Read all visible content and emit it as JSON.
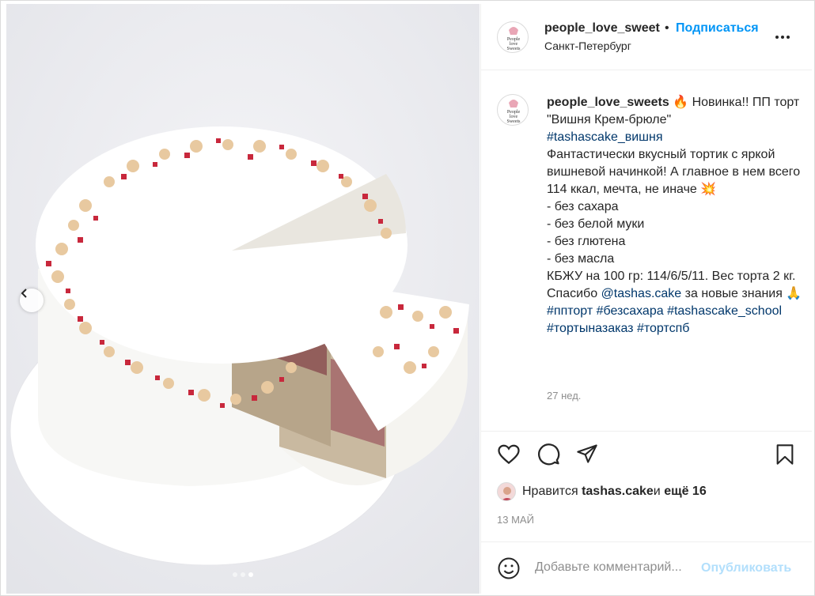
{
  "post": {
    "username": "people_love_sweet",
    "separator": "•",
    "follow_label": "Подписаться",
    "location": "Санкт-Петербург"
  },
  "caption": {
    "username": "people_love_sweets",
    "fire_emoji": "🔥",
    "line1": " Новинка!! ПП торт \"Вишня Крем-брюле\"",
    "tag1": "#tashascake_вишня",
    "text1": "Фантастически вкусный тортик с яркой вишневой начинкой! А главное в нем всего 114 ккал, мечта, не иначе ",
    "boom_emoji": "💥",
    "items": [
      "- без сахара",
      "- без белой муки",
      "- без глютена",
      "- без масла"
    ],
    "kbju": "КБЖУ на 100 гр: 114/6/5/11. Вес торта 2 кг.",
    "thanks_pre": "Спасибо ",
    "thanks_mention": "@tashas.cake",
    "thanks_post": " за новые знания ",
    "pray_emoji": "🙏",
    "tags": [
      "#ппторт",
      "#безсахара",
      "#tashascake_school",
      "#тортыназаказ",
      "#тортспб"
    ],
    "time_ago": "27 нед."
  },
  "likes": {
    "prefix": "Нравится ",
    "user": "tashas.cake",
    "middle": " и ",
    "others": "ещё 16"
  },
  "date": "13 МАЙ",
  "comment": {
    "placeholder": "Добавьте комментарий...",
    "publish_label": "Опубликовать"
  },
  "avatar_text": [
    "People",
    "love",
    "Sweets"
  ],
  "carousel": {
    "count": 3,
    "active_index": 2
  },
  "icons": [
    "chevron-left-icon",
    "more-icon",
    "heart-icon",
    "comment-icon",
    "share-icon",
    "bookmark-icon",
    "emoji-icon"
  ],
  "colors": {
    "link": "#0095f6",
    "tag": "#00376b",
    "muted": "#8e8e8e",
    "publish_disabled": "#b2dffc"
  }
}
